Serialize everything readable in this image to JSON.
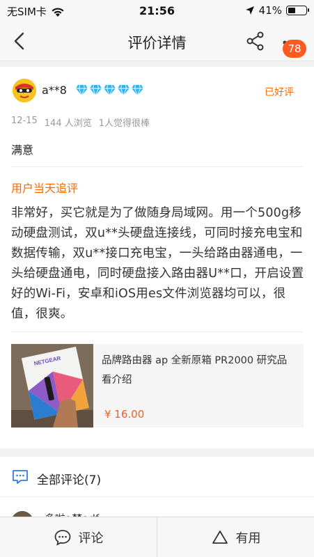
{
  "status_bar": {
    "carrier": "无SIM卡",
    "time": "21:56",
    "battery_percent": "41%",
    "battery_level": 0.41
  },
  "nav": {
    "title": "评价详情",
    "badge_count": "78"
  },
  "review": {
    "user_name": "a**8",
    "diamond_count": 5,
    "rating_label": "已好评",
    "date": "12-15",
    "views": "144 人浏览",
    "likes": "1人觉得很棒",
    "content": "满意",
    "followup_label": "用户当天追评",
    "followup_text": "非常好，买它就是为了做随身局域网。用一个500g移动硬盘测试，双u**头硬盘连接线，可同时接充电宝和数据传输，双u**接口充电宝，一头给路由器通电，一头给硬盘通电，同时硬盘接入路由器U**口，开启设置好的Wi-Fi，安卓和iOS用es文件浏览器均可以，很值，很爽。"
  },
  "product": {
    "title": "品牌路由器 ap 全新原箱 PR2000 研究品 看介绍",
    "price": "¥ 16.00",
    "box_brand": "NETGEAR"
  },
  "comments": {
    "title": "全部评论(7)",
    "preview_name": "多啦a梦adf"
  },
  "bottom_bar": {
    "comment_label": "评论",
    "useful_label": "有用"
  },
  "colors": {
    "accent": "#ff6a00",
    "badge": "#ff5a1f",
    "diamond": "#29b6f6"
  }
}
